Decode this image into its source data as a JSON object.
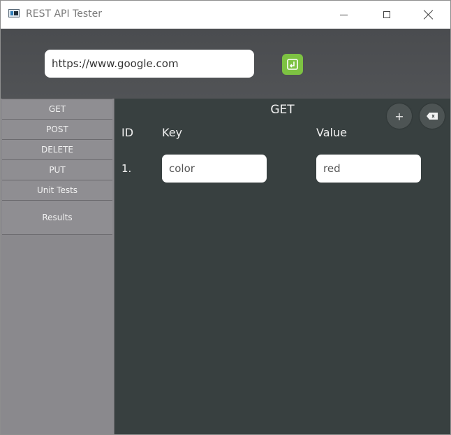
{
  "window": {
    "title": "REST API Tester"
  },
  "url_bar": {
    "value": "https://www.google.com",
    "send_icon": "send-icon"
  },
  "sidebar": {
    "items": [
      {
        "label": "GET"
      },
      {
        "label": "POST"
      },
      {
        "label": "DELETE"
      },
      {
        "label": "PUT"
      },
      {
        "label": "Unit Tests"
      },
      {
        "label": "Results"
      }
    ]
  },
  "main": {
    "title": "GET",
    "columns": {
      "id": "ID",
      "key": "Key",
      "value": "Value"
    },
    "rows": [
      {
        "id": "1.",
        "key": "color",
        "value": "red"
      }
    ],
    "add_label": "+",
    "clear_icon": "backspace-icon"
  },
  "colors": {
    "accent": "#7dc242",
    "panel": "#384040",
    "sidebar": "#8a898d",
    "header": "#4a4c4f"
  }
}
